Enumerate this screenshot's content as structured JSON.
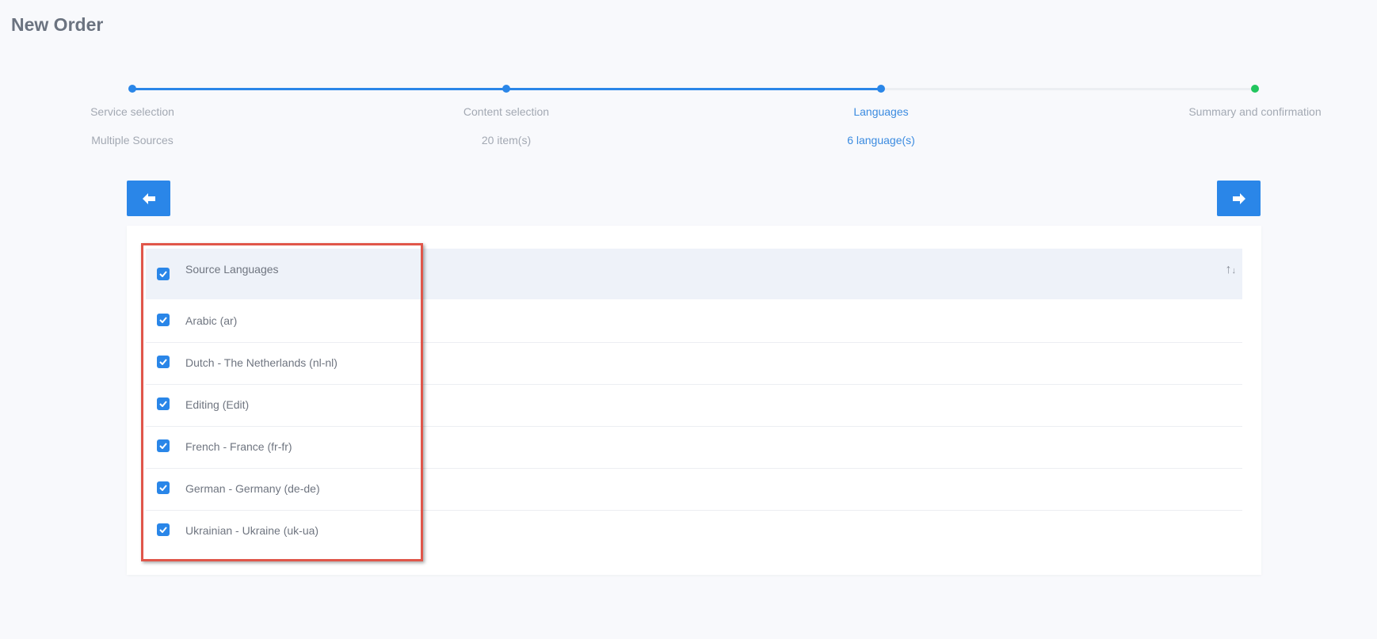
{
  "page": {
    "title": "New Order"
  },
  "stepper": {
    "steps": [
      {
        "label": "Service selection",
        "sub": "Multiple Sources"
      },
      {
        "label": "Content selection",
        "sub": "20 item(s)"
      },
      {
        "label": "Languages",
        "sub": "6 language(s)"
      },
      {
        "label": "Summary and confirmation",
        "sub": ""
      }
    ],
    "active_step": "Languages",
    "colors": {
      "done": "#2a86e8",
      "pending": "#eceef2",
      "final": "#22c55e"
    }
  },
  "nav": {
    "back_icon": "arrow-left-icon",
    "next_icon": "arrow-right-icon"
  },
  "table": {
    "header": {
      "label": "Source Languages",
      "checked": true,
      "sort_icon": "sort-icon"
    },
    "rows": [
      {
        "label": "Arabic (ar)",
        "checked": true
      },
      {
        "label": "Dutch - The Netherlands (nl-nl)",
        "checked": true
      },
      {
        "label": "Editing (Edit)",
        "checked": true
      },
      {
        "label": "French - France (fr-fr)",
        "checked": true
      },
      {
        "label": "German - Germany (de-de)",
        "checked": true
      },
      {
        "label": "Ukrainian - Ukraine (uk-ua)",
        "checked": true
      }
    ]
  },
  "highlight_color": "#e0564a"
}
